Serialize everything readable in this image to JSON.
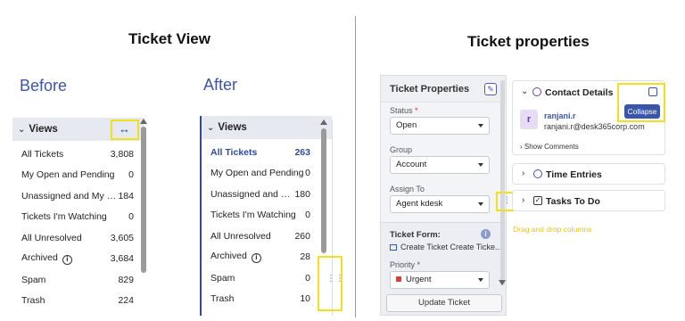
{
  "headings": {
    "ticket_view": "Ticket View",
    "ticket_properties": "Ticket properties",
    "before": "Before",
    "after": "After"
  },
  "before_panel": {
    "header": "Views",
    "rows": [
      {
        "label": "All Tickets",
        "count": "3,808"
      },
      {
        "label": "My Open and Pending",
        "count": "0"
      },
      {
        "label": "Unassigned and My Op...",
        "count": "184"
      },
      {
        "label": "Tickets I'm Watching",
        "count": "0"
      },
      {
        "label": "All Unresolved",
        "count": "3,605"
      },
      {
        "label": "Archived",
        "count": "3,684"
      },
      {
        "label": "Spam",
        "count": "829"
      },
      {
        "label": "Trash",
        "count": "224"
      }
    ]
  },
  "after_panel": {
    "header": "Views",
    "rows": [
      {
        "label": "All Tickets",
        "count": "263"
      },
      {
        "label": "My Open and Pending",
        "count": "0"
      },
      {
        "label": "Unassigned and My ...",
        "count": "180"
      },
      {
        "label": "Tickets I'm Watching",
        "count": "0"
      },
      {
        "label": "All Unresolved",
        "count": "260"
      },
      {
        "label": "Archived",
        "count": "28"
      },
      {
        "label": "Spam",
        "count": "0"
      },
      {
        "label": "Trash",
        "count": "10"
      }
    ]
  },
  "ticket_properties": {
    "title": "Ticket Properties",
    "status_label": "Status",
    "status_value": "Open",
    "group_label": "Group",
    "group_value": "Account",
    "assign_label": "Assign To",
    "assign_value": "Agent kdesk",
    "form_label": "Ticket Form:",
    "form_value": "Create Ticket Create Ticke...",
    "priority_label": "Priority",
    "priority_value": "Urgent",
    "update_button": "Update Ticket",
    "required_mark": "*"
  },
  "contact_details": {
    "title": "Contact Details",
    "avatar_letter": "r",
    "name": "ranjani.r",
    "email": "ranjani.r@desk365corp.com",
    "show_comments": "Show Comments",
    "collapse_tooltip": "Collapse"
  },
  "time_entries": {
    "title": "Time Entries"
  },
  "tasks": {
    "title": "Tasks To Do"
  },
  "hint_text": "Drag and drop columns",
  "colors": {
    "accent": "#3b55a8",
    "highlight_box": "#f0e020",
    "priority_urgent": "#d93c3c"
  }
}
